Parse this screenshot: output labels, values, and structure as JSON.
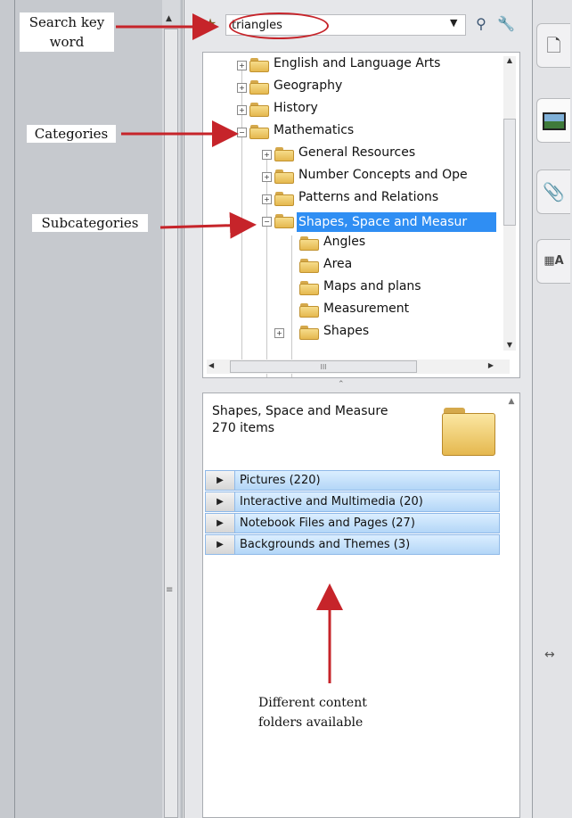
{
  "annotations": {
    "search_line1": "Search key",
    "search_line2": "word",
    "categories": "Categories",
    "subcategories": "Subcategories",
    "content_line1": "Different content",
    "content_line2": "folders available"
  },
  "search": {
    "value": "triangles"
  },
  "tree": {
    "items": [
      {
        "label": "English and Language Arts",
        "level": 0,
        "expander": "+"
      },
      {
        "label": "Geography",
        "level": 0,
        "expander": "+"
      },
      {
        "label": "History",
        "level": 0,
        "expander": "+"
      },
      {
        "label": "Mathematics",
        "level": 0,
        "expander": "−"
      },
      {
        "label": "General Resources",
        "level": 1,
        "expander": "+"
      },
      {
        "label": "Number Concepts and Ope",
        "level": 1,
        "expander": "+"
      },
      {
        "label": "Patterns and Relations",
        "level": 1,
        "expander": "+"
      },
      {
        "label": "Shapes, Space and Measur",
        "level": 1,
        "expander": "−",
        "selected": true
      },
      {
        "label": "Angles",
        "level": 2
      },
      {
        "label": "Area",
        "level": 2
      },
      {
        "label": "Maps and plans",
        "level": 2
      },
      {
        "label": "Measurement",
        "level": 2
      },
      {
        "label": "Shapes",
        "level": 2,
        "expander": "+"
      }
    ],
    "hscroll_grip": "III"
  },
  "detail": {
    "title": "Shapes, Space and Measure",
    "count": "270 items",
    "rows": [
      {
        "label": "Pictures (220)"
      },
      {
        "label": "Interactive and Multimedia (20)"
      },
      {
        "label": "Notebook Files and Pages (27)"
      },
      {
        "label": "Backgrounds and Themes (3)"
      }
    ]
  },
  "icons": {
    "search": "magnifier-icon",
    "settings": "wrench-icon",
    "page_tab": "page-icon",
    "gallery_tab": "image-icon",
    "attachments_tab": "paperclip-icon",
    "properties_tab": "properties-icon",
    "resize": "resize-icon"
  },
  "colors": {
    "annotation_arrow": "#c6242a",
    "selection": "#2f8ef3",
    "content_row": "#b3d6f7"
  }
}
